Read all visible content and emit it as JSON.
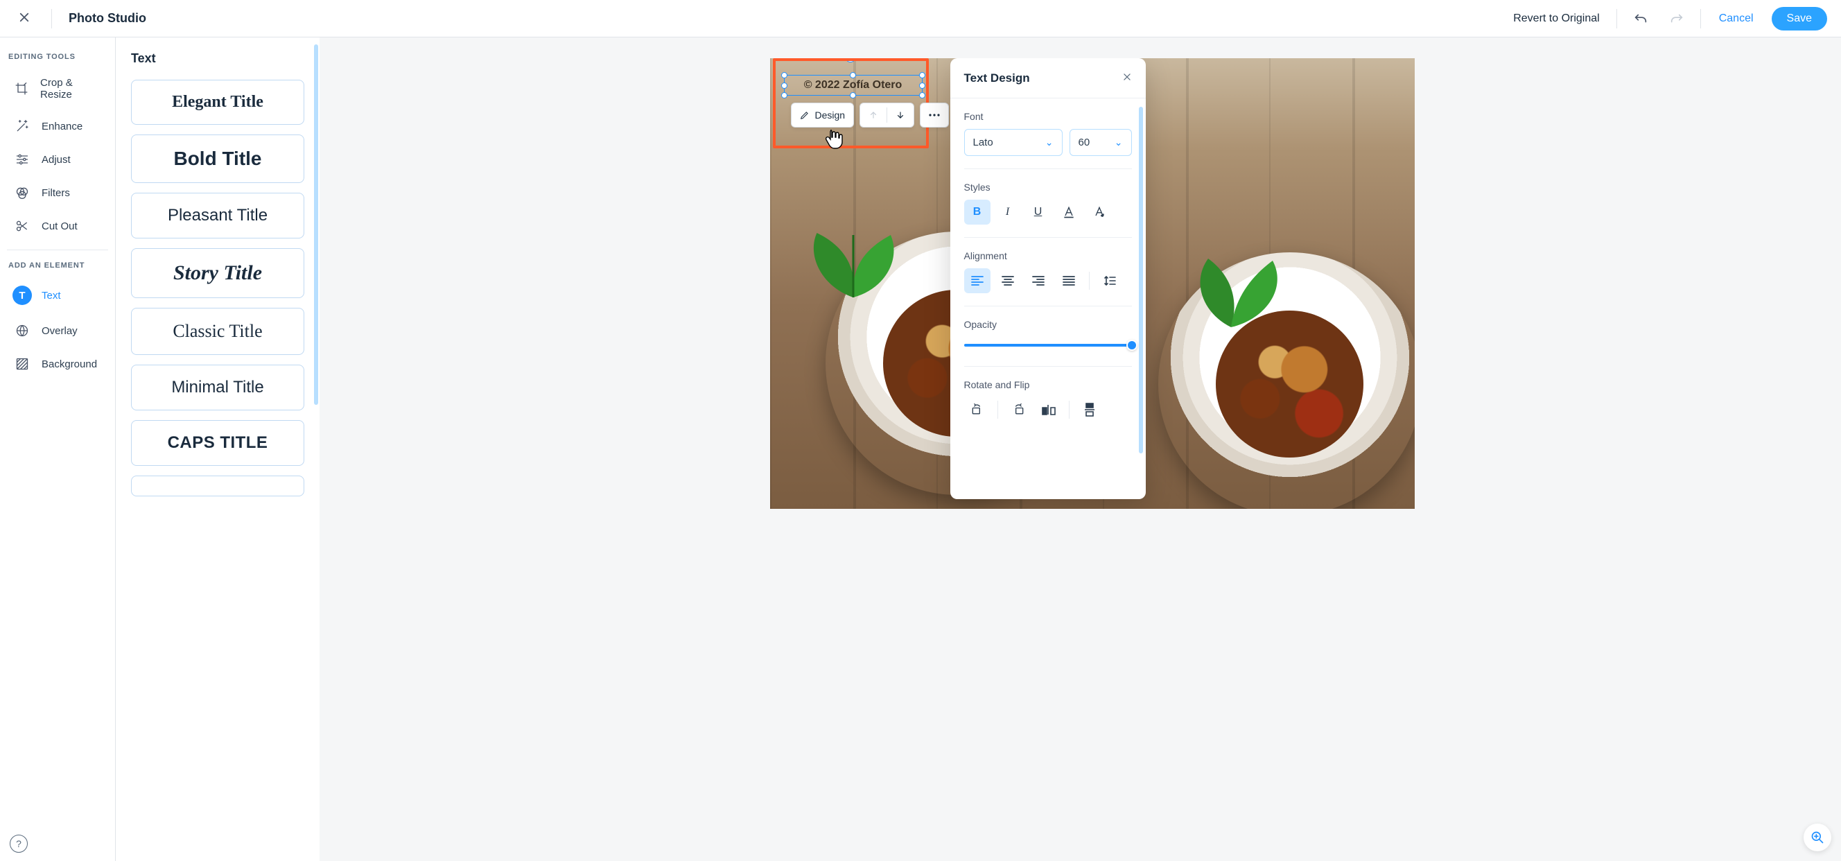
{
  "header": {
    "title": "Photo Studio",
    "revert": "Revert to Original",
    "cancel": "Cancel",
    "save": "Save"
  },
  "sidebar": {
    "sections": {
      "editing_tools": {
        "heading": "EDITING TOOLS",
        "items": [
          "Crop & Resize",
          "Enhance",
          "Adjust",
          "Filters",
          "Cut Out"
        ]
      },
      "add_element": {
        "heading": "ADD AN ELEMENT",
        "items": [
          "Text",
          "Overlay",
          "Background"
        ],
        "active_index": 0
      }
    }
  },
  "presets": {
    "title": "Text",
    "items": [
      {
        "label": "Elegant Title",
        "style": "elegant"
      },
      {
        "label": "Bold Title",
        "style": "bold"
      },
      {
        "label": "Pleasant Title",
        "style": "pleasant"
      },
      {
        "label": "Story Title",
        "style": "story"
      },
      {
        "label": "Classic Title",
        "style": "classic"
      },
      {
        "label": "Minimal Title",
        "style": "minimal"
      },
      {
        "label": "CAPS TITLE",
        "style": "caps"
      }
    ]
  },
  "canvas": {
    "selected_text": "© 2022 Zofía Otero",
    "mini_toolbar": {
      "design": "Design"
    }
  },
  "design_panel": {
    "title": "Text Design",
    "font_label": "Font",
    "font_family": "Lato",
    "font_size": "60",
    "styles_label": "Styles",
    "styles": {
      "bold": "B",
      "italic": "I",
      "underline": "U"
    },
    "alignment_label": "Alignment",
    "opacity_label": "Opacity",
    "opacity_percent": 100,
    "rotate_label": "Rotate and Flip"
  }
}
